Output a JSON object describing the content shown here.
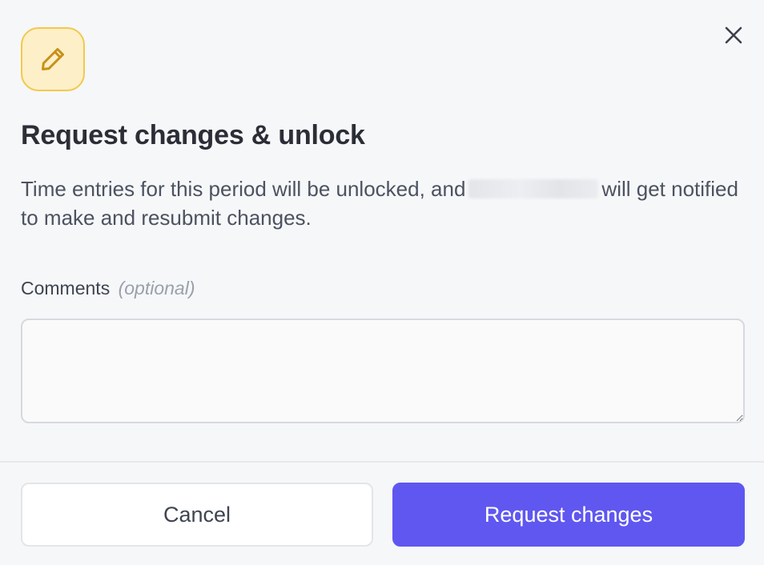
{
  "dialog": {
    "title": "Request changes & unlock",
    "description_before": "Time entries for this period will be unlocked, and",
    "description_after": "will get notified to make and resubmit changes.",
    "close_icon": "close-icon",
    "header_icon": "pencil-icon",
    "accent_badge_bg": "#fdefc8",
    "accent_badge_border": "#f2c94c"
  },
  "form": {
    "comments_label": "Comments",
    "comments_optional": "(optional)",
    "comments_value": "",
    "comments_placeholder": ""
  },
  "actions": {
    "cancel_label": "Cancel",
    "submit_label": "Request changes",
    "primary_color": "#5f57f0"
  }
}
